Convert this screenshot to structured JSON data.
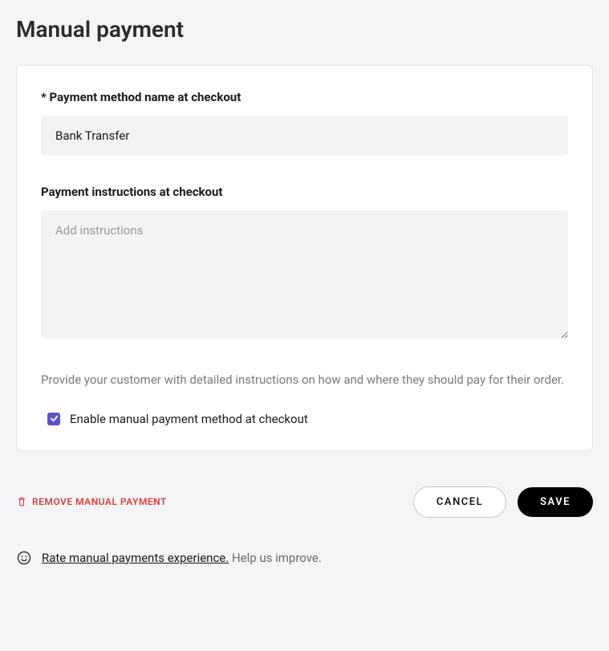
{
  "page": {
    "title": "Manual payment"
  },
  "form": {
    "name_label": "* Payment method name at checkout",
    "name_value": "Bank Transfer",
    "instructions_label": "Payment instructions at checkout",
    "instructions_placeholder": "Add instructions",
    "instructions_value": "",
    "help_text": "Provide your customer with detailed instructions on how and where they should pay for their order.",
    "enable_checkbox_checked": true,
    "enable_checkbox_label": "Enable manual payment method at checkout"
  },
  "actions": {
    "remove_label": "REMOVE MANUAL PAYMENT",
    "cancel_label": "CANCEL",
    "save_label": "SAVE"
  },
  "feedback": {
    "link_text": "Rate manual payments experience.",
    "tail_text": " Help us improve."
  }
}
